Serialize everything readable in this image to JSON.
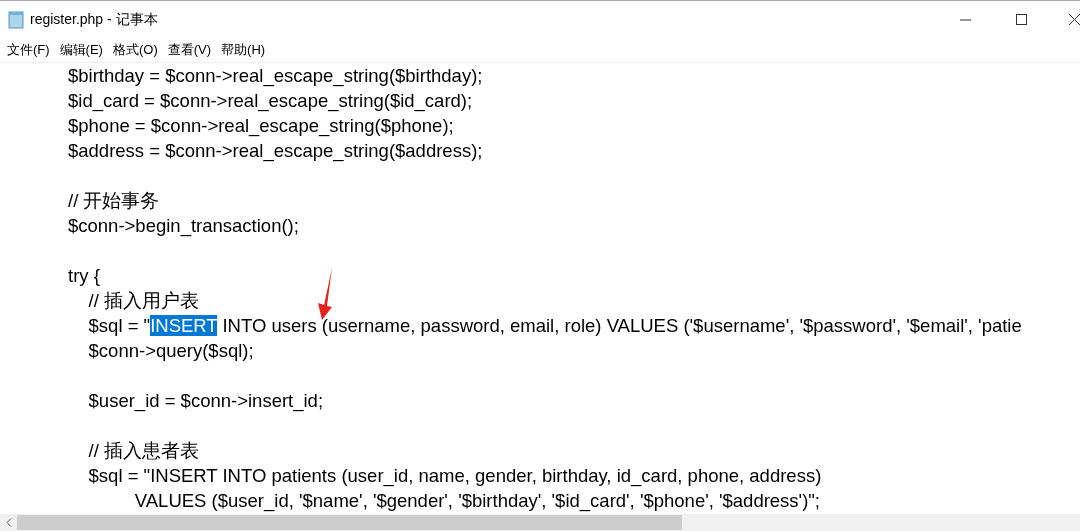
{
  "window": {
    "title": "register.php - 记事本"
  },
  "menu": [
    {
      "label": "文件(F)"
    },
    {
      "label": "编辑(E)"
    },
    {
      "label": "格式(O)"
    },
    {
      "label": "查看(V)"
    },
    {
      "label": "帮助(H)"
    }
  ],
  "editor": {
    "lines": [
      {
        "kind": "code",
        "segments": [
          {
            "text": "$birthday = $conn->real_escape_string($birthday);",
            "selected": false
          }
        ]
      },
      {
        "kind": "code",
        "segments": [
          {
            "text": "$id_card = $conn->real_escape_string($id_card);",
            "selected": false
          }
        ]
      },
      {
        "kind": "code",
        "segments": [
          {
            "text": "$phone = $conn->real_escape_string($phone);",
            "selected": false
          }
        ]
      },
      {
        "kind": "code",
        "segments": [
          {
            "text": "$address = $conn->real_escape_string($address);",
            "selected": false
          }
        ]
      },
      {
        "kind": "blank"
      },
      {
        "kind": "code",
        "segments": [
          {
            "text": "// 开始事务",
            "selected": false
          }
        ]
      },
      {
        "kind": "code",
        "segments": [
          {
            "text": "$conn->begin_transaction();",
            "selected": false
          }
        ]
      },
      {
        "kind": "blank"
      },
      {
        "kind": "code",
        "segments": [
          {
            "text": "try {",
            "selected": false
          }
        ]
      },
      {
        "kind": "code",
        "segments": [
          {
            "text": "    // 插入用户表",
            "selected": false
          }
        ]
      },
      {
        "kind": "code",
        "segments": [
          {
            "text": "    $sql = \"",
            "selected": false
          },
          {
            "text": "INSERT",
            "selected": true
          },
          {
            "text": " INTO users (username, password, email, role) VALUES ('$username', '$password', '$email', 'patie",
            "selected": false
          }
        ]
      },
      {
        "kind": "code",
        "segments": [
          {
            "text": "    $conn->query($sql);",
            "selected": false
          }
        ]
      },
      {
        "kind": "blank"
      },
      {
        "kind": "code",
        "segments": [
          {
            "text": "    $user_id = $conn->insert_id;",
            "selected": false
          }
        ]
      },
      {
        "kind": "blank"
      },
      {
        "kind": "code",
        "segments": [
          {
            "text": "    // 插入患者表",
            "selected": false
          }
        ]
      },
      {
        "kind": "code",
        "segments": [
          {
            "text": "    $sql = \"INSERT INTO patients (user_id, name, gender, birthday, id_card, phone, address)",
            "selected": false
          }
        ]
      },
      {
        "kind": "code",
        "segments": [
          {
            "text": "             VALUES ($user_id, '$name', '$gender', '$birthday', '$id_card', '$phone', '$address')\";",
            "selected": false
          }
        ]
      }
    ]
  }
}
